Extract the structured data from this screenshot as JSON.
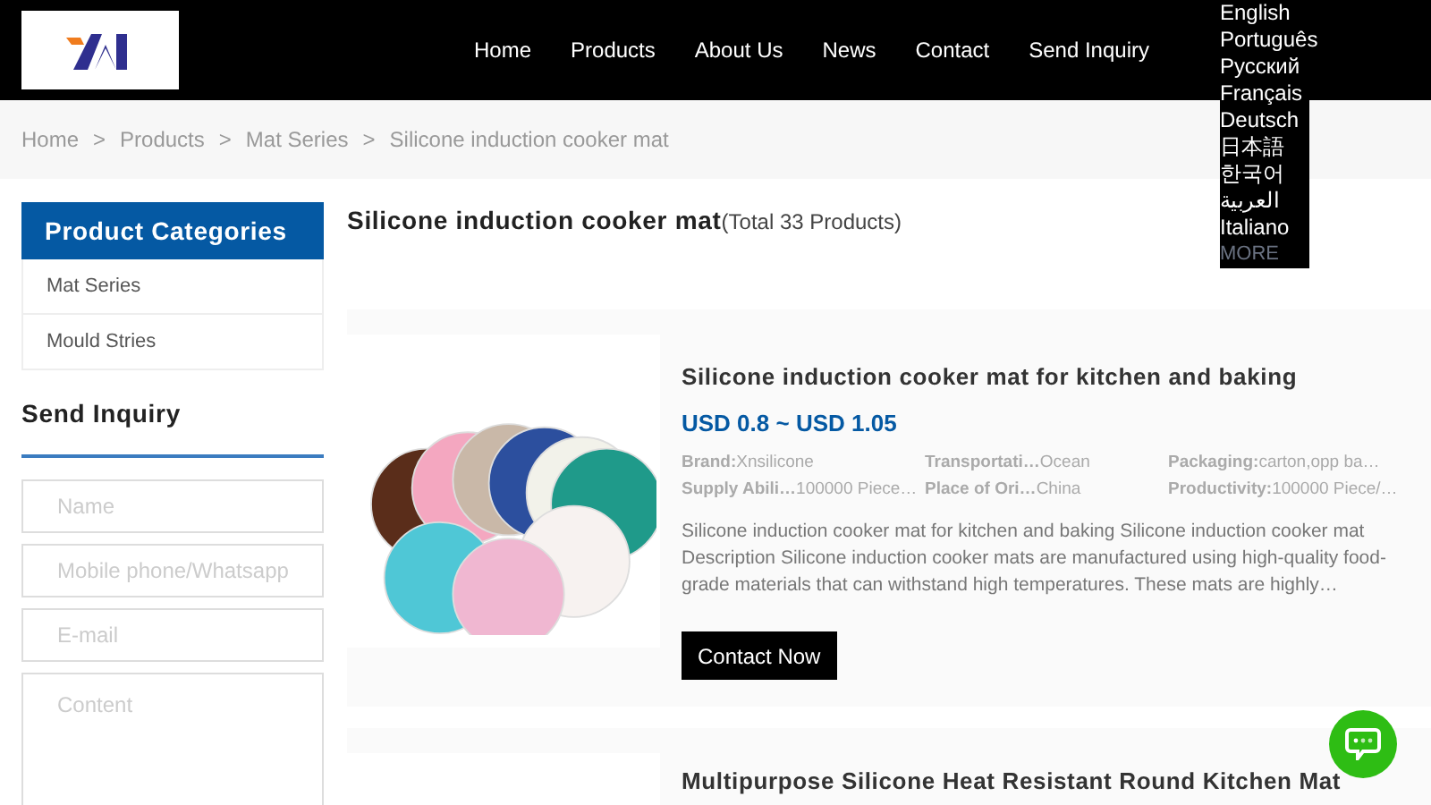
{
  "nav": {
    "items": [
      "Home",
      "Products",
      "About Us",
      "News",
      "Contact",
      "Send Inquiry"
    ]
  },
  "languages": [
    "English",
    "Português",
    "Русский",
    "Français",
    "Deutsch",
    "日本語",
    "한국어",
    "العربية",
    "Italiano",
    "MORE"
  ],
  "breadcrumb": [
    "Home",
    "Products",
    "Mat Series",
    "Silicone induction cooker mat"
  ],
  "breadcrumb_separator": ">",
  "sidebar": {
    "title": "Product Categories",
    "categories": [
      "Mat Series",
      "Mould Stries"
    ],
    "inquiry_title": "Send Inquiry",
    "fields": [
      {
        "kind": "input",
        "placeholder": "Name"
      },
      {
        "kind": "input",
        "placeholder": "Mobile phone/Whatsapp"
      },
      {
        "kind": "input",
        "placeholder": "E-mail"
      },
      {
        "kind": "textarea",
        "placeholder": "Content"
      }
    ]
  },
  "page_title": "Silicone induction cooker mat",
  "total": "(Total 33 Products)",
  "products": [
    {
      "title": "Silicone induction cooker mat for kitchen and baking",
      "price": "USD 0.8 ~ USD 1.05",
      "specs": [
        {
          "label": "Brand:",
          "value": "Xnsilicone"
        },
        {
          "label": "Transportati…",
          "value": "Ocean"
        },
        {
          "label": "Packaging:",
          "value": "carton,opp ba…"
        },
        {
          "label": "Supply Abili…",
          "value": "100000 Piece…"
        },
        {
          "label": "Place of Ori…",
          "value": "China"
        },
        {
          "label": "Productivity:",
          "value": "100000 Piece/…"
        }
      ],
      "description": "Silicone induction cooker mat for kitchen and baking Silicone induction cooker mat Description Silicone induction cooker mats are manufactured using high-quality food-grade materials that can withstand high temperatures. These mats are highly…",
      "button": "Contact Now"
    },
    {
      "title": "Multipurpose Silicone Heat Resistant Round Kitchen Mat"
    }
  ]
}
